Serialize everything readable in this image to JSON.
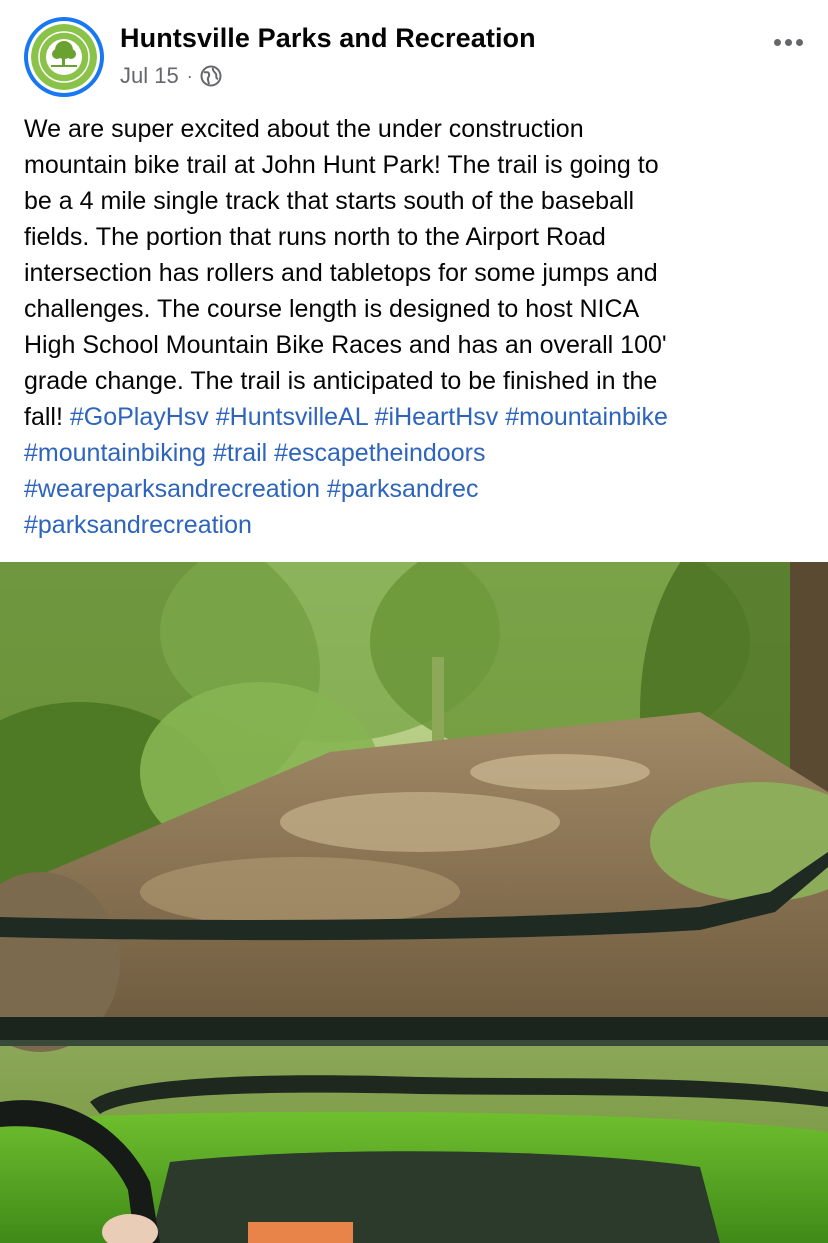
{
  "post": {
    "page_name": "Huntsville Parks and Recreation",
    "date": "Jul 15",
    "separator": "·",
    "audience_icon": "globe-icon",
    "more_icon": "more-options-icon",
    "body_lines": [
      "We are super excited about the under construction",
      "mountain bike trail at John Hunt Park! The trail is going to",
      "be a 4 mile single track that starts south of the baseball",
      "fields. The portion that runs north to the Airport Road",
      "intersection has rollers and tabletops for some jumps and",
      "challenges. The course length is designed to host NICA",
      "High School Mountain Bike Races and has an overall 100'",
      "grade change. The trail is anticipated to be finished in the"
    ],
    "last_line_prefix": "fall! ",
    "hashtags_line9": [
      "#GoPlayHsv",
      "#HuntsvilleAL",
      "#iHeartHsv",
      "#mountainbike"
    ],
    "hashtags_line10": [
      "#mountainbiking",
      "#trail",
      "#escapetheindoors"
    ],
    "hashtags_line11": [
      "#weareparksandrecreation",
      "#parksandrec"
    ],
    "hashtags_line12": [
      "#parksandrecreation"
    ],
    "colors": {
      "hashtag": "#2d64bc",
      "avatar_ring": "#1877f2",
      "logo_green": "#8bc34a",
      "meta_gray": "#65676b"
    }
  },
  "photo": {
    "subject": "trail-photo-from-utv"
  }
}
